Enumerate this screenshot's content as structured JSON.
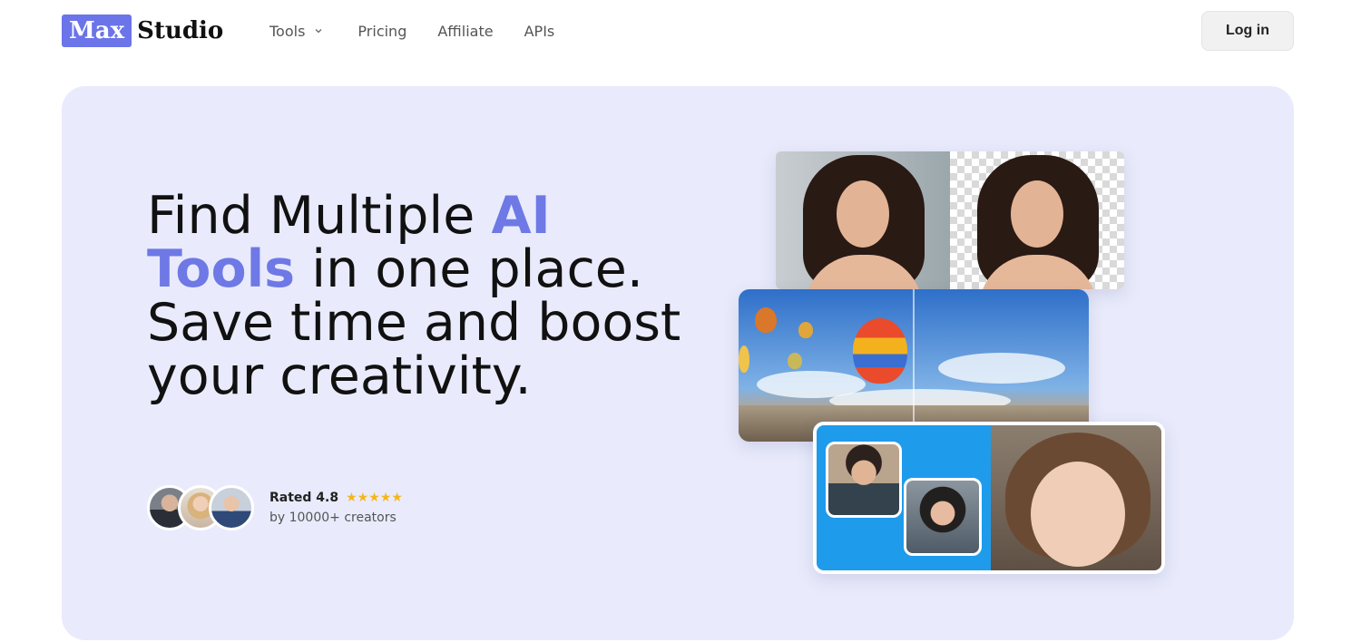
{
  "header": {
    "logo": {
      "box_text": "Max",
      "text": "Studio"
    },
    "nav": [
      {
        "label": "Tools",
        "has_dropdown": true,
        "icon": "chevron-down-icon"
      },
      {
        "label": "Pricing"
      },
      {
        "label": "Affiliate"
      },
      {
        "label": "APIs"
      }
    ],
    "login_label": "Log in"
  },
  "hero": {
    "headline": {
      "part1": "Find Multiple ",
      "accent": "AI Tools",
      "part2": " in one place. Save time and boost your creativity."
    },
    "rating": {
      "label": "Rated 4.8",
      "stars": "★★★★★",
      "star_count": 5,
      "subtext": "by 10000+ creators"
    }
  },
  "colors": {
    "brand": "#6b74e8",
    "accent_text": "#6e79e6",
    "hero_bg": "#e9ebfc",
    "star": "#f5b61c"
  }
}
